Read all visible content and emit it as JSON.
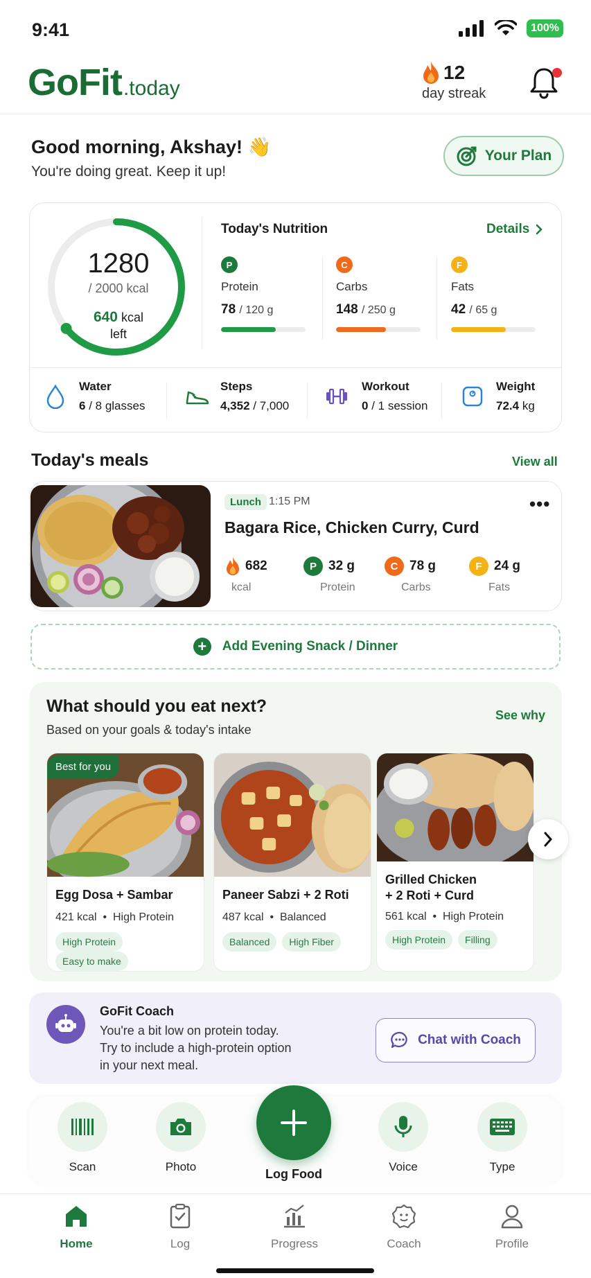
{
  "status": {
    "time": "9:41",
    "battery": "100%"
  },
  "header": {
    "logo_main": "GoFit",
    "logo_suffix": ".today",
    "streak_count": "12",
    "streak_label": "day streak"
  },
  "greeting": {
    "title": "Good morning, Akshay! 👋",
    "subtitle": "You're doing great. Keep it up!",
    "plan_button": "Your Plan"
  },
  "nutrition": {
    "calories": "1280",
    "goal": "/ 2000 kcal",
    "left_value": "640",
    "left_unit": "kcal",
    "left_label": "left",
    "calorie_progress": 0.64,
    "title": "Today's Nutrition",
    "details_link": "Details",
    "macros": [
      {
        "badge": "P",
        "label": "Protein",
        "value": "78",
        "goal": "/ 120 g",
        "progress": 0.65,
        "color": "#1f9a45"
      },
      {
        "badge": "C",
        "label": "Carbs",
        "value": "148",
        "goal": "/ 250 g",
        "progress": 0.59,
        "color": "#f06a1c"
      },
      {
        "badge": "F",
        "label": "Fats",
        "value": "42",
        "goal": "/ 65 g",
        "progress": 0.65,
        "color": "#f4b214"
      }
    ],
    "stats": [
      {
        "icon": "water-drop-icon",
        "title": "Water",
        "value": "6",
        "rest": " / 8 glasses"
      },
      {
        "icon": "shoe-icon",
        "title": "Steps",
        "value": "4,352",
        "rest": " / 7,000"
      },
      {
        "icon": "dumbbell-icon",
        "title": "Workout",
        "value": "0",
        "rest": " / 1 session"
      },
      {
        "icon": "scale-icon",
        "title": "Weight",
        "value": "72.4",
        "rest": " kg"
      }
    ]
  },
  "meals": {
    "section_title": "Today's meals",
    "view_all": "View all",
    "lunch": {
      "tag": "Lunch",
      "time": "1:15 PM",
      "name": "Bagara Rice, Chicken Curry, Curd",
      "kcal": "682",
      "kcal_label": "kcal",
      "protein": "32 g",
      "protein_label": "Protein",
      "carbs": "78 g",
      "carbs_label": "Carbs",
      "fats": "24 g",
      "fats_label": "Fats"
    },
    "add_snack": "Add Evening Snack / Dinner"
  },
  "suggestions": {
    "title": "What should you eat next?",
    "subtitle": "Based on your goals & today's intake",
    "see_why": "See why",
    "best_tag": "Best for you",
    "items": [
      {
        "name1": "Egg Dosa + Sambar",
        "name2": "",
        "kcal": "421 kcal",
        "tag": "High Protein",
        "chips": [
          "High Protein",
          "Easy to make"
        ]
      },
      {
        "name1": "Paneer Sabzi + 2 Roti",
        "name2": "",
        "kcal": "487 kcal",
        "tag": "Balanced",
        "chips": [
          "Balanced",
          "High Fiber"
        ]
      },
      {
        "name1": "Grilled Chicken",
        "name2": "+ 2 Roti + Curd",
        "kcal": "561 kcal",
        "tag": "High Protein",
        "chips": [
          "High Protein",
          "Filling"
        ]
      }
    ]
  },
  "coach": {
    "title": "GoFit Coach",
    "line1": "You're a bit low on protein today.",
    "line2": "Try to include a high-protein option",
    "line3": "in your next meal.",
    "chat_button": "Chat with Coach"
  },
  "quick_actions": {
    "scan": "Scan",
    "photo": "Photo",
    "log_food": "Log Food",
    "voice": "Voice",
    "type": "Type"
  },
  "tabs": {
    "home": "Home",
    "log": "Log",
    "progress": "Progress",
    "coach": "Coach",
    "profile": "Profile"
  }
}
